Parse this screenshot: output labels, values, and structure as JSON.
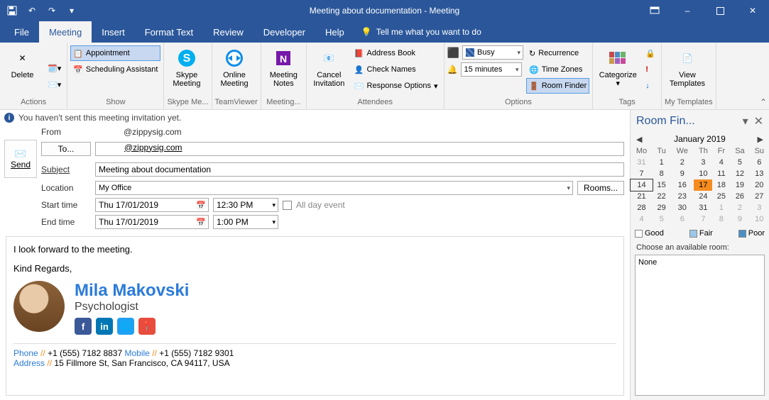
{
  "window": {
    "title": "Meeting about documentation  -  Meeting"
  },
  "tabs": {
    "file": "File",
    "meeting": "Meeting",
    "insert": "Insert",
    "format": "Format Text",
    "review": "Review",
    "developer": "Developer",
    "help": "Help",
    "tell_me": "Tell me what you want to do"
  },
  "ribbon": {
    "actions": {
      "delete": "Delete",
      "label": "Actions"
    },
    "show": {
      "appointment": "Appointment",
      "scheduling": "Scheduling Assistant",
      "label": "Show"
    },
    "skype": {
      "btn": "Skype\nMeeting",
      "label": "Skype Me..."
    },
    "teamviewer": {
      "btn": "Online\nMeeting",
      "label": "TeamViewer"
    },
    "notes": {
      "btn": "Meeting\nNotes",
      "label": "Meeting..."
    },
    "cancel": {
      "btn": "Cancel\nInvitation"
    },
    "attendees": {
      "address": "Address Book",
      "check": "Check Names",
      "response": "Response Options",
      "label": "Attendees"
    },
    "options": {
      "show_as": "Busy",
      "reminder": "15 minutes",
      "recurrence": "Recurrence",
      "tz": "Time Zones",
      "room": "Room Finder",
      "label": "Options"
    },
    "tags": {
      "categorize": "Categorize",
      "label": "Tags"
    },
    "templates": {
      "view": "View\nTemplates",
      "label": "My Templates"
    }
  },
  "info": "You haven't sent this meeting invitation yet.",
  "form": {
    "from_label": "From",
    "from_value": "@zippysig.com",
    "to_label": "To...",
    "to_value": "@zippysig.com",
    "subject_label": "Subject",
    "subject_value": "Meeting about documentation",
    "location_label": "Location",
    "location_value": "My Office",
    "rooms": "Rooms...",
    "start_label": "Start time",
    "start_date": "Thu 17/01/2019",
    "start_time": "12:30 PM",
    "end_label": "End time",
    "end_date": "Thu 17/01/2019",
    "end_time": "1:00 PM",
    "allday": "All day event",
    "send": "Send"
  },
  "body": {
    "line1": "I look forward to the meeting.",
    "line2": "Kind Regards,",
    "sig_name": "Mila Makovski",
    "sig_title": "Psychologist",
    "phone_k": "Phone",
    "phone_v": "+1 (555) 7182 8837",
    "mobile_k": "Mobile",
    "mobile_v": "+1 (555) 7182 9301",
    "address_k": "Address",
    "address_v": "15 Fillmore St, San Francisco, CA 94117, USA"
  },
  "side": {
    "title": "Room Fin...",
    "month": "January 2019",
    "dow": [
      "Mo",
      "Tu",
      "We",
      "Th",
      "Fr",
      "Sa",
      "Su"
    ],
    "weeks": [
      [
        {
          "d": "31",
          "dim": true
        },
        {
          "d": "1"
        },
        {
          "d": "2"
        },
        {
          "d": "3"
        },
        {
          "d": "4"
        },
        {
          "d": "5"
        },
        {
          "d": "6"
        }
      ],
      [
        {
          "d": "7"
        },
        {
          "d": "8"
        },
        {
          "d": "9"
        },
        {
          "d": "10"
        },
        {
          "d": "11"
        },
        {
          "d": "12"
        },
        {
          "d": "13"
        }
      ],
      [
        {
          "d": "14",
          "today": true
        },
        {
          "d": "15"
        },
        {
          "d": "16"
        },
        {
          "d": "17",
          "sel": true
        },
        {
          "d": "18"
        },
        {
          "d": "19"
        },
        {
          "d": "20"
        }
      ],
      [
        {
          "d": "21"
        },
        {
          "d": "22"
        },
        {
          "d": "23"
        },
        {
          "d": "24"
        },
        {
          "d": "25"
        },
        {
          "d": "26"
        },
        {
          "d": "27"
        }
      ],
      [
        {
          "d": "28"
        },
        {
          "d": "29"
        },
        {
          "d": "30"
        },
        {
          "d": "31"
        },
        {
          "d": "1",
          "dim": true
        },
        {
          "d": "2",
          "dim": true
        },
        {
          "d": "3",
          "dim": true
        }
      ],
      [
        {
          "d": "4",
          "dim": true
        },
        {
          "d": "5",
          "dim": true
        },
        {
          "d": "6",
          "dim": true
        },
        {
          "d": "7",
          "dim": true
        },
        {
          "d": "8",
          "dim": true
        },
        {
          "d": "9",
          "dim": true
        },
        {
          "d": "10",
          "dim": true
        }
      ]
    ],
    "legend": {
      "good": "Good",
      "fair": "Fair",
      "poor": "Poor"
    },
    "choose": "Choose an available room:",
    "none": "None"
  }
}
